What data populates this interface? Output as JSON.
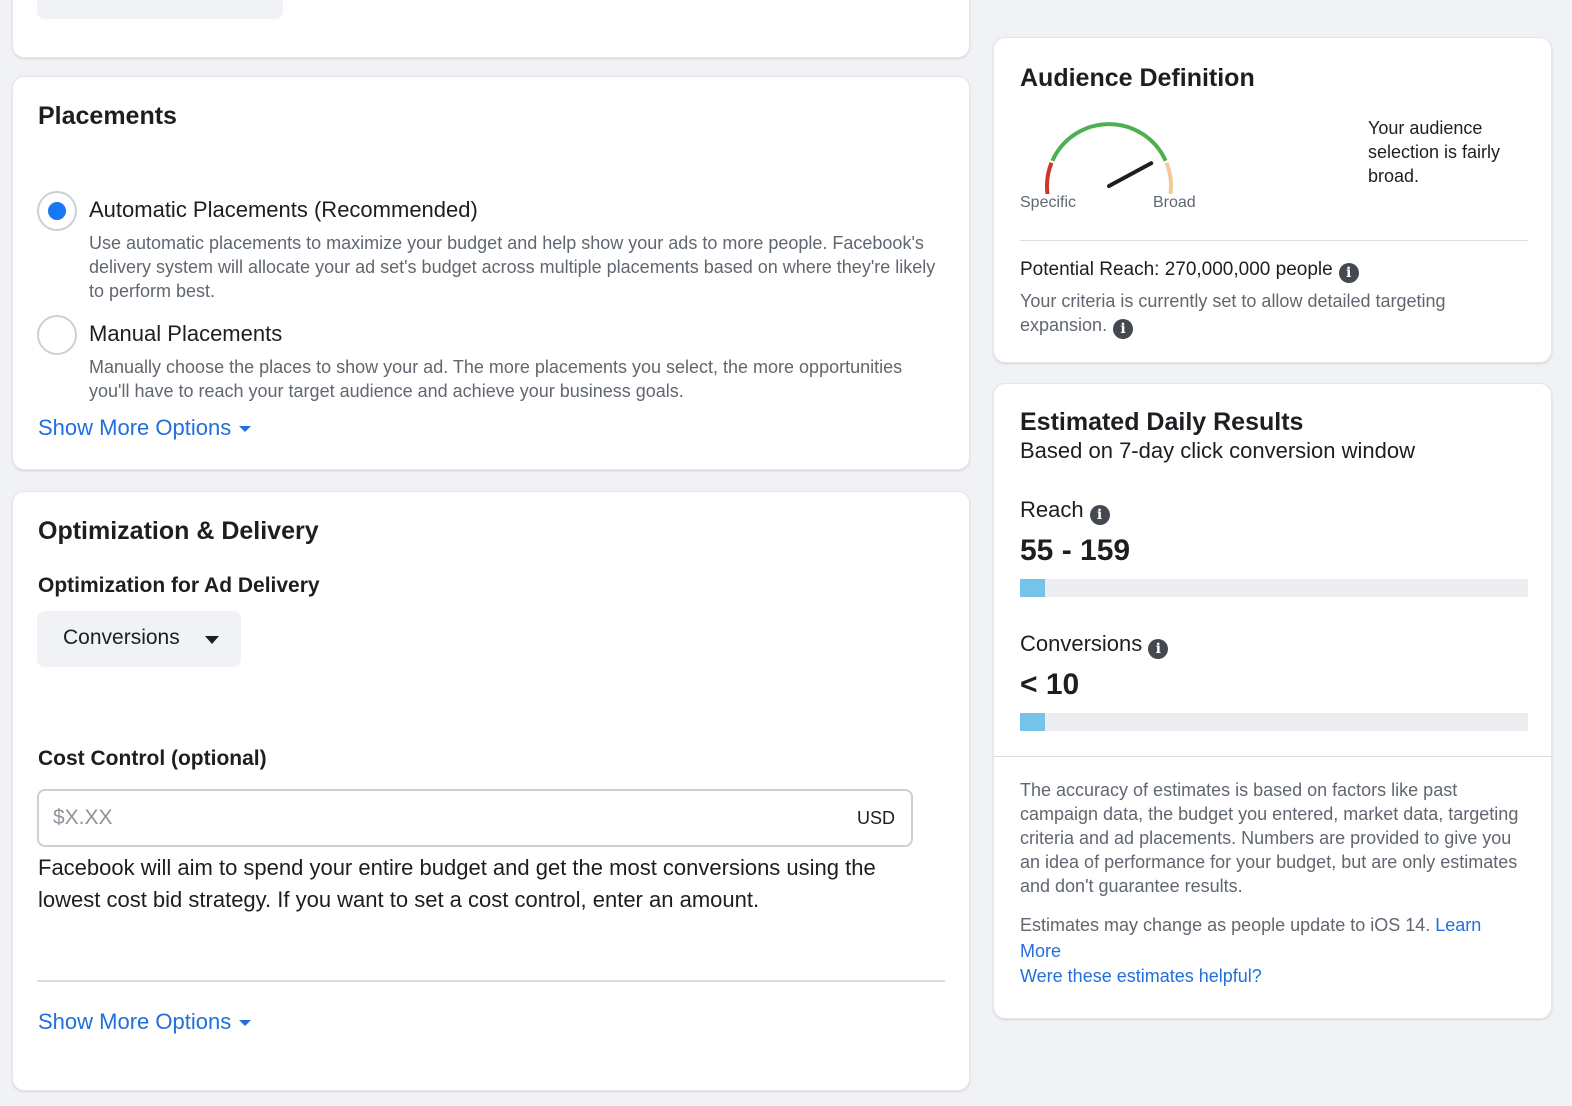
{
  "placements": {
    "title": "Placements",
    "options": [
      {
        "label": "Automatic Placements (Recommended)",
        "description": "Use automatic placements to maximize your budget and help show your ads to more people. Facebook's delivery system will allocate your ad set's budget across multiple placements based on where they're likely to perform best.",
        "selected": true
      },
      {
        "label": "Manual Placements",
        "description": "Manually choose the places to show your ad. The more placements you select, the more opportunities you'll have to reach your target audience and achieve your business goals.",
        "selected": false
      }
    ],
    "show_more": "Show More Options"
  },
  "optimization": {
    "title": "Optimization & Delivery",
    "delivery_label": "Optimization for Ad Delivery",
    "delivery_value": "Conversions",
    "cost_control_label": "Cost Control (optional)",
    "cost_placeholder": "$X.XX",
    "cost_currency": "USD",
    "cost_help": "Facebook will aim to spend your entire budget and get the most conversions using the lowest cost bid strategy. If you want to set a cost control, enter an amount.",
    "show_more": "Show More Options"
  },
  "audience": {
    "title": "Audience Definition",
    "gauge_low_label": "Specific",
    "gauge_high_label": "Broad",
    "gauge_level": 0.78,
    "note": "Your audience selection is fairly broad.",
    "potential_reach": "Potential Reach: 270,000,000 people",
    "criteria": "Your criteria is currently set to allow detailed targeting expansion."
  },
  "results": {
    "title": "Estimated Daily Results",
    "subtitle": "Based on 7-day click conversion window",
    "metrics": [
      {
        "label": "Reach",
        "value": "55 - 159",
        "fill": 0.05
      },
      {
        "label": "Conversions",
        "value": "< 10",
        "fill": 0.05
      }
    ],
    "accuracy": "The accuracy of estimates is based on factors like past campaign data, the budget you entered, market data, targeting criteria and ad placements. Numbers are provided to give you an idea of performance for your budget, but are only estimates and don't guarantee results.",
    "ios_note": "Estimates may change as people update to iOS 14.",
    "learn_more": "Learn More",
    "helpful": "Were these estimates helpful?"
  },
  "colors": {
    "accent": "#1877f2",
    "link": "#216fdb",
    "bar_fill": "#74c3e8",
    "gauge_red": "#d0342c",
    "gauge_green": "#4caf50",
    "gauge_peach": "#f5c99b"
  },
  "icons": [
    "info-icon",
    "caret-down-icon",
    "gauge-needle-icon"
  ]
}
